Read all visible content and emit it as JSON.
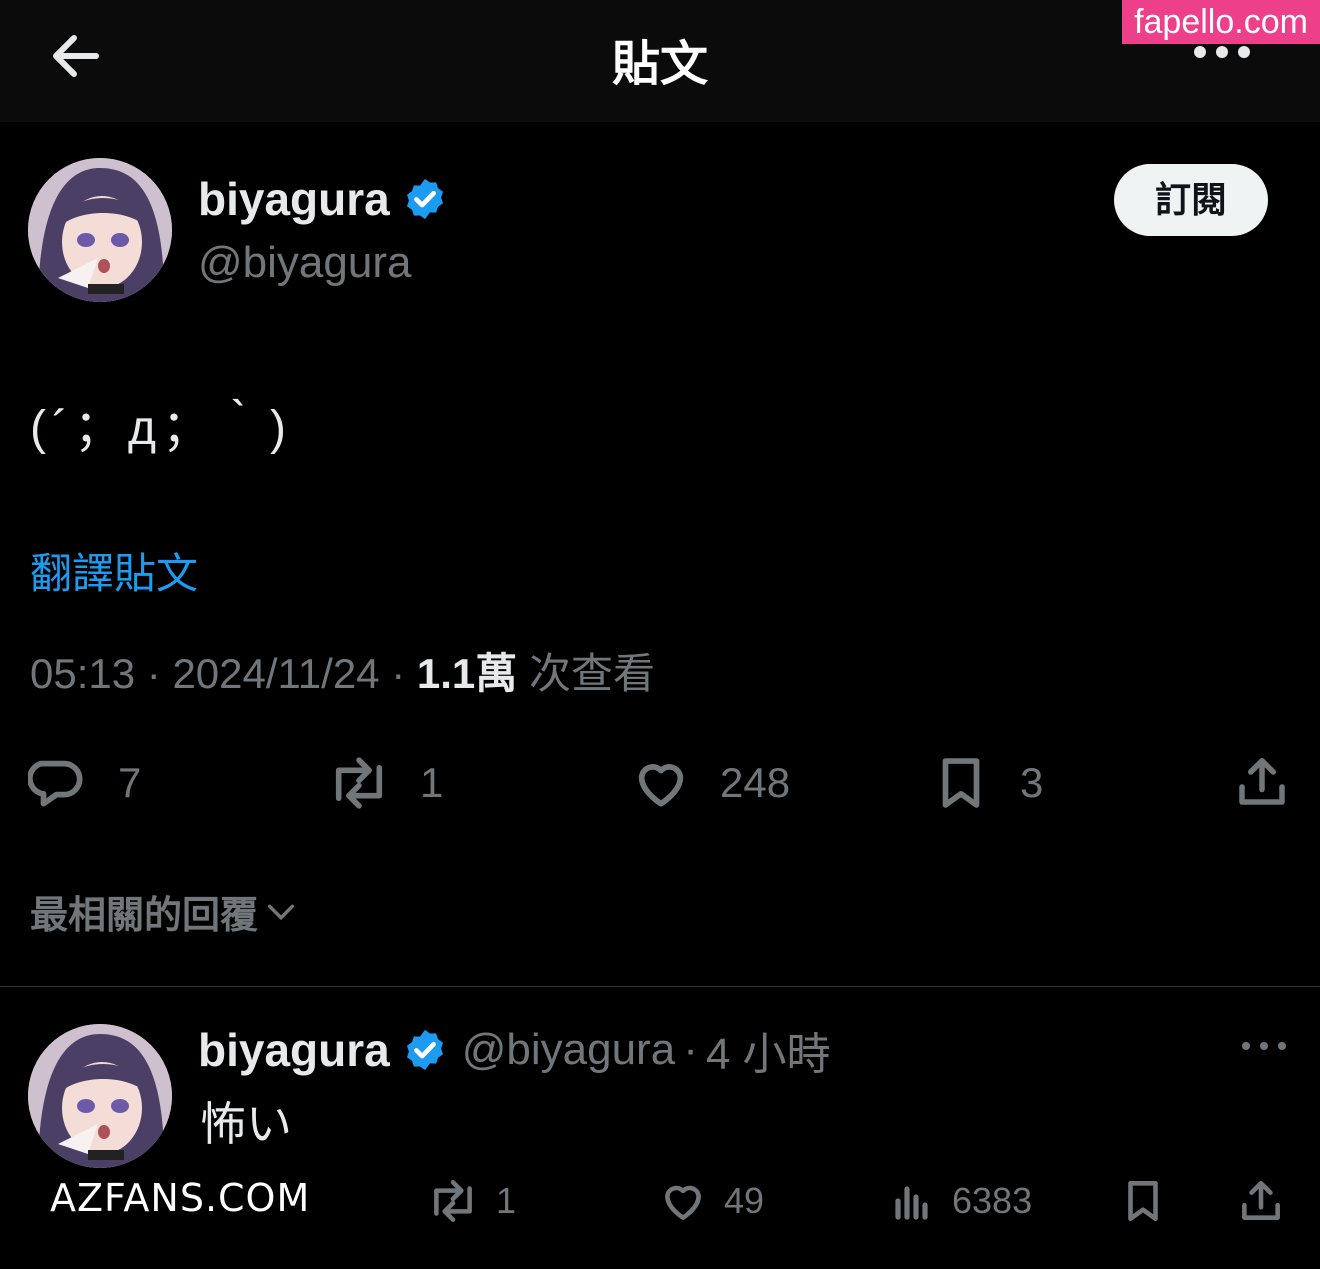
{
  "header": {
    "title": "貼文"
  },
  "watermarks": {
    "top": "fapello.com",
    "bottom": "AZFANS.COM"
  },
  "post": {
    "display_name": "biyagura",
    "handle": "@biyagura",
    "subscribe_label": "訂閱",
    "text": "(´；д；｀)",
    "translate_label": "翻譯貼文",
    "time": "05:13",
    "date": "2024/11/24",
    "views_count": "1.1萬",
    "views_label": "次查看",
    "separator": "·",
    "actions": {
      "replies": "7",
      "reposts": "1",
      "likes": "248",
      "bookmarks": "3"
    }
  },
  "replies_sort_label": "最相關的回覆",
  "reply": {
    "display_name": "biyagura",
    "handle": "@biyagura",
    "age": "4 小時",
    "text": "怖い",
    "actions": {
      "reposts": "1",
      "likes": "49",
      "views": "6383"
    }
  },
  "colors": {
    "background": "#000000",
    "link": "#1d9bf0",
    "muted": "#71767b",
    "verified": "#1d9bf0",
    "watermark": "#ee3f8b"
  }
}
